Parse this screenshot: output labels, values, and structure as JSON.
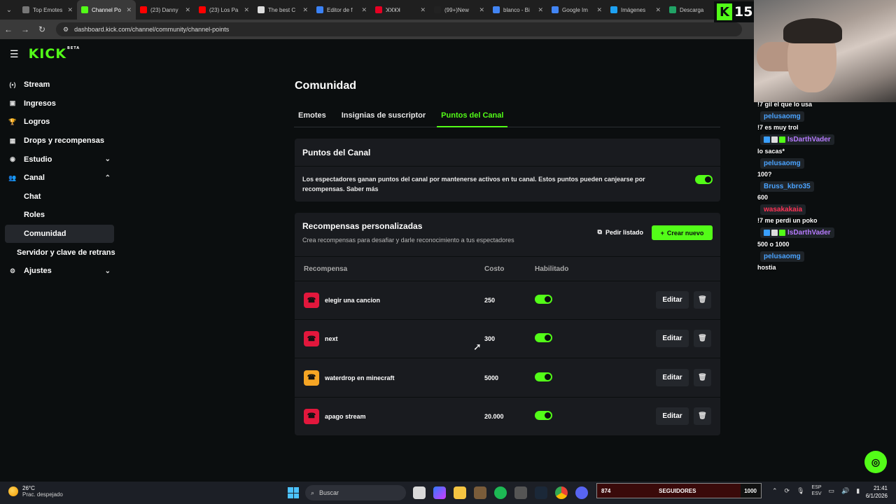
{
  "browser": {
    "tabs": [
      {
        "label": "Top Emotes",
        "color": "#777777"
      },
      {
        "label": "Channel Po",
        "color": "#53fc18"
      },
      {
        "label": "(23) Danny",
        "color": "#ff0000"
      },
      {
        "label": "(23) Los Pa",
        "color": "#ff0000"
      },
      {
        "label": "The best C",
        "color": "#dddddd"
      },
      {
        "label": "Editor de f",
        "color": "#3b82f6"
      },
      {
        "label": "ꓘꓘꓘꓘ",
        "color": "#e60023"
      },
      {
        "label": "(99+)New",
        "color": "#222222"
      },
      {
        "label": "blanco - Bi",
        "color": "#4285f4"
      },
      {
        "label": "Google Im",
        "color": "#4285f4"
      },
      {
        "label": "Imágenes",
        "color": "#1da1f2"
      },
      {
        "label": "Descarga",
        "color": "#21a366"
      }
    ],
    "tab_close": "✕",
    "url": "dashboard.kick.com/channel/community/channel-points"
  },
  "sidebar": {
    "logo": "KICK",
    "logo_badge": "BETA",
    "items": [
      {
        "label": "Stream",
        "icon": "(•)"
      },
      {
        "label": "Ingresos",
        "icon": "▣"
      },
      {
        "label": "Logros",
        "icon": "🏆"
      },
      {
        "label": "Drops y recompensas",
        "icon": "▦"
      },
      {
        "label": "Estudio",
        "icon": "◉"
      },
      {
        "label": "Canal",
        "icon": "👥"
      },
      {
        "label": "Chat"
      },
      {
        "label": "Roles"
      },
      {
        "label": "Comunidad"
      },
      {
        "label": "Servidor y clave de retrans"
      },
      {
        "label": "Ajustes",
        "icon": "⚙"
      }
    ]
  },
  "page": {
    "title": "Comunidad",
    "tabs": [
      "Emotes",
      "Insignias de suscriptor",
      "Puntos del Canal"
    ],
    "points_card": {
      "title": "Puntos del Canal",
      "description": "Los espectadores ganan puntos del canal por mantenerse activos en tu canal. Estos puntos pueden canjearse por recompensas. Saber más",
      "enabled": true
    },
    "rewards_card": {
      "title": "Recompensas personalizadas",
      "subtitle": "Crea recompensas para desafiar y darle reconocimiento a tus espectadores",
      "list_button": "Pedir listado",
      "new_button": "Crear nuevo",
      "columns": [
        "Recompensa",
        "Costo",
        "Habilitado"
      ],
      "rows": [
        {
          "name": "elegir una cancion",
          "cost": "250",
          "enabled": true,
          "icon_color": "#e2173c"
        },
        {
          "name": "next",
          "cost": "300",
          "enabled": true,
          "icon_color": "#e2173c"
        },
        {
          "name": "waterdrop en minecraft",
          "cost": "5000",
          "enabled": true,
          "icon_color": "#f5a524"
        },
        {
          "name": "apago stream",
          "cost": "20.000",
          "enabled": true,
          "icon_color": "#e2173c"
        }
      ],
      "edit_label": "Editar"
    }
  },
  "overlay": {
    "score_badge": "K",
    "score": "15",
    "chat": [
      {
        "type": "msg",
        "text": "!7 gil el que lo usa"
      },
      {
        "type": "user",
        "name": "pelusaomg",
        "color": "#4aa3ff"
      },
      {
        "type": "msg",
        "text": "!7 es muy trol"
      },
      {
        "type": "user",
        "name": "IsDarthVader",
        "color": "#b77bff",
        "badges": true
      },
      {
        "type": "msg",
        "text": "lo sacas*"
      },
      {
        "type": "user",
        "name": "pelusaomg",
        "color": "#4aa3ff"
      },
      {
        "type": "msg",
        "text": "100?"
      },
      {
        "type": "user",
        "name": "Bruss_kbro35",
        "color": "#4aa3ff"
      },
      {
        "type": "msg",
        "text": "600"
      },
      {
        "type": "user",
        "name": "wasakakaia",
        "color": "#ff3355"
      },
      {
        "type": "msg",
        "text": "!7 me perdi un poko"
      },
      {
        "type": "user",
        "name": "IsDarthVader",
        "color": "#b77bff",
        "badges": true
      },
      {
        "type": "msg",
        "text": "500 o 1000"
      },
      {
        "type": "user",
        "name": "pelusaomg",
        "color": "#4aa3ff"
      },
      {
        "type": "msg",
        "text": "hostia"
      }
    ]
  },
  "taskbar": {
    "weather_temp": "26°C",
    "weather_desc": "Prac. despejado",
    "search_placeholder": "Buscar",
    "followers_current": "874",
    "followers_label": "SEGUIDORES",
    "followers_goal": "1000",
    "followers_progress": 0.874,
    "lang_line1": "ESP",
    "lang_line2": "ESV",
    "time": "21:41",
    "date": "6/1/2026"
  },
  "colors": {
    "accent": "#53fc18",
    "bg": "#0b0e0f",
    "card": "#191b1f"
  }
}
